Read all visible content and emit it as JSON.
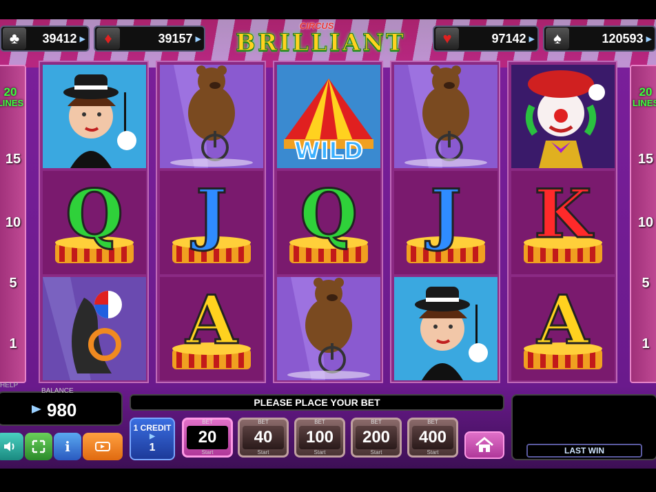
{
  "logo": {
    "small": "CIRCUS",
    "big": "BRILLIANT"
  },
  "jackpots": [
    {
      "suit": "club",
      "glyph": "♣",
      "color": "#ffffff",
      "value": "39412"
    },
    {
      "suit": "diamond",
      "glyph": "♦",
      "color": "#e02020",
      "value": "39157"
    },
    {
      "suit": "heart",
      "glyph": "♥",
      "color": "#e02020",
      "value": "97142"
    },
    {
      "suit": "spade",
      "glyph": "♠",
      "color": "#ffffff",
      "value": "120593"
    }
  ],
  "lines": {
    "count": "20",
    "label": "LINES",
    "markers": [
      "15",
      "10",
      "5",
      "1"
    ]
  },
  "reels": [
    [
      "ringmaster-woman",
      "Q",
      "seal-with-ball"
    ],
    [
      "bear-on-unicycle",
      "J",
      "A"
    ],
    [
      "wild-tent",
      "Q",
      "bear-on-unicycle"
    ],
    [
      "bear-on-unicycle",
      "J",
      "ringmaster-woman"
    ],
    [
      "clown",
      "K",
      "A"
    ]
  ],
  "wild_label": "WILD",
  "letter_colors": {
    "Q": "#2fd13a",
    "J": "#2f8cff",
    "K": "#ff2a2a",
    "A": "#ffd21f"
  },
  "help_label": "HELP",
  "balance": {
    "label": "BALANCE",
    "value": "980"
  },
  "message": "PLEASE PLACE YOUR BET",
  "credit": {
    "label": "1 CREDIT",
    "value": "1"
  },
  "bets": {
    "label": "BET",
    "start_label": "Start",
    "values": [
      "20",
      "40",
      "100",
      "200",
      "400"
    ],
    "active_index": 0
  },
  "last_win_label": "LAST WIN",
  "controls": {
    "sound": "speaker-icon",
    "fullscreen": "fullscreen-icon",
    "info": "i",
    "autoplay": "autoplay-icon"
  }
}
